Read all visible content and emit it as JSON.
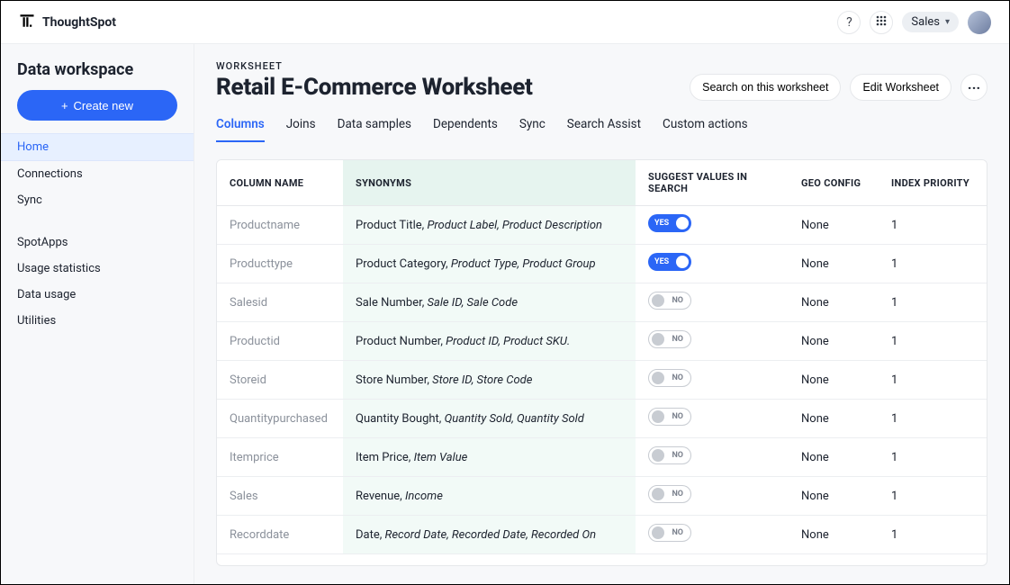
{
  "brand": {
    "name": "ThoughtSpot"
  },
  "topbar": {
    "user_label": "Sales"
  },
  "sidebar": {
    "title": "Data workspace",
    "create_label": "Create new",
    "groups": [
      {
        "items": [
          {
            "label": "Home",
            "active": true
          },
          {
            "label": "Connections",
            "active": false
          },
          {
            "label": "Sync",
            "active": false
          }
        ]
      },
      {
        "items": [
          {
            "label": "SpotApps",
            "active": false
          },
          {
            "label": "Usage statistics",
            "active": false
          },
          {
            "label": "Data usage",
            "active": false
          },
          {
            "label": "Utilities",
            "active": false
          }
        ]
      }
    ]
  },
  "page": {
    "kicker": "WORKSHEET",
    "title": "Retail E-Commerce Worksheet",
    "actions": {
      "search": "Search on this worksheet",
      "edit": "Edit Worksheet"
    },
    "tabs": [
      {
        "label": "Columns",
        "active": true
      },
      {
        "label": "Joins",
        "active": false
      },
      {
        "label": "Data samples",
        "active": false
      },
      {
        "label": "Dependents",
        "active": false
      },
      {
        "label": "Sync",
        "active": false
      },
      {
        "label": "Search Assist",
        "active": false
      },
      {
        "label": "Custom actions",
        "active": false
      }
    ]
  },
  "table": {
    "headers": {
      "column_name": "COLUMN NAME",
      "synonyms": "SYNONYMS",
      "suggest": "SUGGEST VALUES IN SEARCH",
      "geo": "GEO CONFIG",
      "index": "INDEX PRIORITY"
    },
    "toggle_labels": {
      "on": "YES",
      "off": "NO"
    },
    "rows": [
      {
        "name": "Productname",
        "syn_plain": "Product Title, ",
        "syn_italic": "Product Label, Product Description",
        "suggest": true,
        "geo": "None",
        "index": "1"
      },
      {
        "name": "Producttype",
        "syn_plain": "Product Category, ",
        "syn_italic": "Product Type, Product Group",
        "suggest": true,
        "geo": "None",
        "index": "1"
      },
      {
        "name": "Salesid",
        "syn_plain": "Sale Number, ",
        "syn_italic": "Sale ID, Sale Code",
        "suggest": false,
        "geo": "None",
        "index": "1"
      },
      {
        "name": "Productid",
        "syn_plain": "Product Number, ",
        "syn_italic": "Product ID, Product SKU.",
        "suggest": false,
        "geo": "None",
        "index": "1"
      },
      {
        "name": "Storeid",
        "syn_plain": "Store Number, ",
        "syn_italic": "Store ID, Store Code",
        "suggest": false,
        "geo": "None",
        "index": "1"
      },
      {
        "name": "Quantitypurchased",
        "syn_plain": "Quantity Bought, ",
        "syn_italic": "Quantity Sold, Quantity Sold",
        "suggest": false,
        "geo": "None",
        "index": "1"
      },
      {
        "name": "Itemprice",
        "syn_plain": "Item Price, ",
        "syn_italic": "Item Value",
        "suggest": false,
        "geo": "None",
        "index": "1"
      },
      {
        "name": "Sales",
        "syn_plain": "Revenue, ",
        "syn_italic": "Income",
        "suggest": false,
        "geo": "None",
        "index": "1"
      },
      {
        "name": "Recorddate",
        "syn_plain": "Date, ",
        "syn_italic": "Record Date, Recorded Date, Recorded On",
        "suggest": false,
        "geo": "None",
        "index": "1"
      }
    ]
  }
}
